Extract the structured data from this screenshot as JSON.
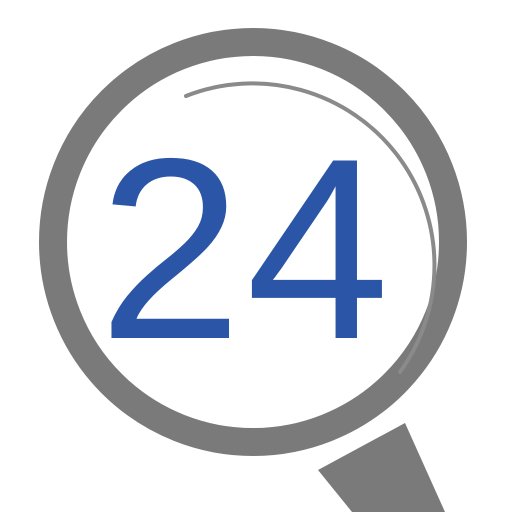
{
  "logo": {
    "number": "24",
    "colors": {
      "number": "#2b55a6",
      "frame": "#7a7a7a",
      "glare": "#8a8a8a",
      "lens": "#ffffff"
    },
    "icon": "magnifying-glass-icon"
  }
}
